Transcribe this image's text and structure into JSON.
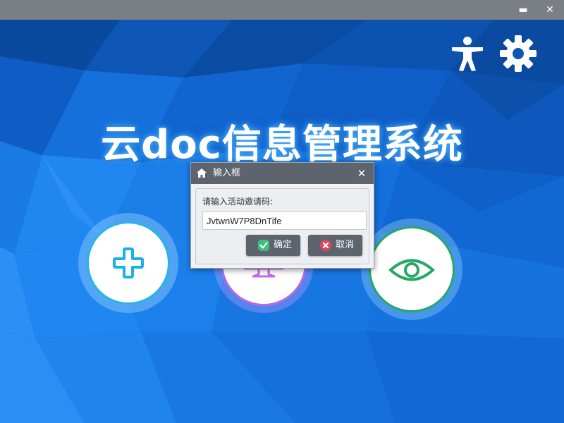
{
  "window": {
    "minimize_label": "▬",
    "close_label": "✕"
  },
  "header_icons": {
    "accessibility": "accessibility-icon",
    "settings": "gear-icon"
  },
  "app": {
    "title": "云doc信息管理系统"
  },
  "actions": [
    {
      "name": "add-button",
      "icon": "plus-icon",
      "color": "#1ab0e8"
    },
    {
      "name": "monitor-button",
      "icon": "monitor-icon",
      "color": "#c36ae6"
    },
    {
      "name": "view-button",
      "icon": "eye-icon",
      "color": "#27a866"
    }
  ],
  "dialog": {
    "title": "输入框",
    "close_label": "✕",
    "label": "请输入活动邀请码:",
    "input_value": "JvtwnW7P8DnTife",
    "ok_label": "确定",
    "cancel_label": "取消"
  },
  "colors": {
    "bg_dark": "#0a4596",
    "bg_light": "#1f86f2",
    "titlebar": "#7a7e85",
    "dialog_header": "#5d646d",
    "ok_icon": "#3bbf7a",
    "cancel_icon": "#e0455f"
  }
}
